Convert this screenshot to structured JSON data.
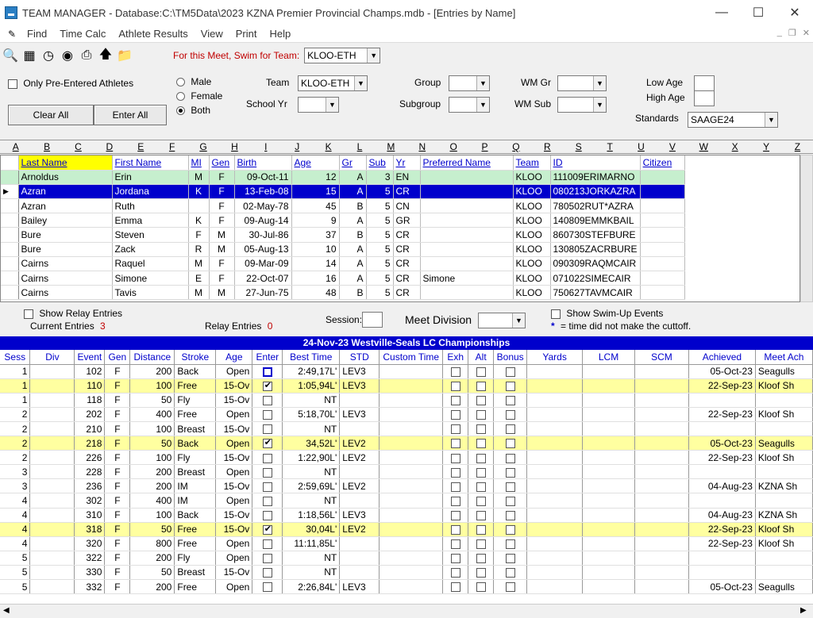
{
  "window": {
    "title": "TEAM MANAGER - Database:C:\\TM5Data\\2023 KZNA Premier Provincial Champs.mdb - [Entries by Name]"
  },
  "menu": [
    "Find",
    "Time Calc",
    "Athlete Results",
    "View",
    "Print",
    "Help"
  ],
  "toolbar": {
    "meet_label": "For this Meet, Swim for Team:",
    "team_value": "KLOO-ETH"
  },
  "filters": {
    "only_pre_entered": "Only Pre-Entered Athletes",
    "clear_all": "Clear All",
    "enter_all": "Enter All",
    "male": "Male",
    "female": "Female",
    "both": "Both",
    "team_label": "Team",
    "team_value": "KLOO-ETH",
    "school_yr_label": "School Yr",
    "group_label": "Group",
    "subgroup_label": "Subgroup",
    "wm_gr_label": "WM Gr",
    "wm_sub_label": "WM Sub",
    "low_age_label": "Low Age",
    "high_age_label": "High Age",
    "standards_label": "Standards",
    "standards_value": "SAAGE24"
  },
  "ruler": [
    "A",
    "B",
    "C",
    "D",
    "E",
    "F",
    "G",
    "H",
    "I",
    "J",
    "K",
    "L",
    "M",
    "N",
    "O",
    "P",
    "Q",
    "R",
    "S",
    "T",
    "U",
    "V",
    "W",
    "X",
    "Y",
    "Z"
  ],
  "athlete_headers": [
    "Last Name",
    "First Name",
    "MI",
    "Gen",
    "Birth",
    "Age",
    "Gr",
    "Sub",
    "Yr",
    "Preferred Name",
    "Team",
    "ID",
    "Citizen"
  ],
  "athletes": [
    [
      "Arnoldus",
      "Erin",
      "M",
      "F",
      "09-Oct-11",
      "12",
      "A",
      "3",
      "EN",
      "",
      "KLOO",
      "111009ERIMARNO",
      ""
    ],
    [
      "Azran",
      "Jordana",
      "K",
      "F",
      "13-Feb-08",
      "15",
      "A",
      "5",
      "CR",
      "",
      "KLOO",
      "080213JORKAZRA",
      ""
    ],
    [
      "Azran",
      "Ruth",
      "",
      "F",
      "02-May-78",
      "45",
      "B",
      "5",
      "CN",
      "",
      "KLOO",
      "780502RUT*AZRA",
      ""
    ],
    [
      "Bailey",
      "Emma",
      "K",
      "F",
      "09-Aug-14",
      "9",
      "A",
      "5",
      "GR",
      "",
      "KLOO",
      "140809EMMKBAIL",
      ""
    ],
    [
      "Bure",
      "Steven",
      "F",
      "M",
      "30-Jul-86",
      "37",
      "B",
      "5",
      "CR",
      "",
      "KLOO",
      "860730STEFBURE",
      ""
    ],
    [
      "Bure",
      "Zack",
      "R",
      "M",
      "05-Aug-13",
      "10",
      "A",
      "5",
      "CR",
      "",
      "KLOO",
      "130805ZACRBURE",
      ""
    ],
    [
      "Cairns",
      "Raquel",
      "M",
      "F",
      "09-Mar-09",
      "14",
      "A",
      "5",
      "CR",
      "",
      "KLOO",
      "090309RAQMCAIR",
      ""
    ],
    [
      "Cairns",
      "Simone",
      "E",
      "F",
      "22-Oct-07",
      "16",
      "A",
      "5",
      "CR",
      "Simone",
      "KLOO",
      "071022SIMECAIR",
      ""
    ],
    [
      "Cairns",
      "Tavis",
      "M",
      "M",
      "27-Jun-75",
      "48",
      "B",
      "5",
      "CR",
      "",
      "KLOO",
      "750627TAVMCAIR",
      ""
    ]
  ],
  "relay": {
    "show_relay": "Show Relay Entries",
    "current_entries_label": "Current Entries",
    "current_entries": "3",
    "relay_entries_label": "Relay Entries",
    "relay_entries": "0",
    "session_label": "Session:",
    "meet_division_label": "Meet Division",
    "show_swimup": "Show Swim-Up Events",
    "cutoff_note": "= time did not make the cuttoff."
  },
  "meet": {
    "title": "24-Nov-23  Westville-Seals LC Championships"
  },
  "event_headers": [
    "Sess",
    "Div",
    "Event",
    "Gen",
    "Distance",
    "Stroke",
    "Age",
    "Enter",
    "Best Time",
    "STD",
    "Custom Time",
    "Exh",
    "Alt",
    "Bonus",
    "Yards",
    "LCM",
    "SCM",
    "Achieved",
    "Meet Ach"
  ],
  "events": [
    {
      "sess": "1",
      "event": "102",
      "gen": "F",
      "dist": "200",
      "stroke": "Back",
      "age": "Open",
      "enter": false,
      "best": "2:49,17L'",
      "std": "LEV3",
      "achieved": "05-Oct-23",
      "meet": "Seagulls"
    },
    {
      "sess": "1",
      "event": "110",
      "gen": "F",
      "dist": "100",
      "stroke": "Free",
      "age": "15-Ov",
      "enter": true,
      "best": "1:05,94L'",
      "std": "LEV3",
      "achieved": "22-Sep-23",
      "meet": "Kloof Sh"
    },
    {
      "sess": "1",
      "event": "118",
      "gen": "F",
      "dist": "50",
      "stroke": "Fly",
      "age": "15-Ov",
      "enter": false,
      "best": "NT",
      "std": "",
      "achieved": "",
      "meet": ""
    },
    {
      "sess": "2",
      "event": "202",
      "gen": "F",
      "dist": "400",
      "stroke": "Free",
      "age": "Open",
      "enter": false,
      "best": "5:18,70L'",
      "std": "LEV3",
      "achieved": "22-Sep-23",
      "meet": "Kloof Sh"
    },
    {
      "sess": "2",
      "event": "210",
      "gen": "F",
      "dist": "100",
      "stroke": "Breast",
      "age": "15-Ov",
      "enter": false,
      "best": "NT",
      "std": "",
      "achieved": "",
      "meet": ""
    },
    {
      "sess": "2",
      "event": "218",
      "gen": "F",
      "dist": "50",
      "stroke": "Back",
      "age": "Open",
      "enter": true,
      "best": "34,52L'",
      "std": "LEV2",
      "achieved": "05-Oct-23",
      "meet": "Seagulls"
    },
    {
      "sess": "2",
      "event": "226",
      "gen": "F",
      "dist": "100",
      "stroke": "Fly",
      "age": "15-Ov",
      "enter": false,
      "best": "1:22,90L'",
      "std": "LEV2",
      "achieved": "22-Sep-23",
      "meet": "Kloof Sh"
    },
    {
      "sess": "3",
      "event": "228",
      "gen": "F",
      "dist": "200",
      "stroke": "Breast",
      "age": "Open",
      "enter": false,
      "best": "NT",
      "std": "",
      "achieved": "",
      "meet": ""
    },
    {
      "sess": "3",
      "event": "236",
      "gen": "F",
      "dist": "200",
      "stroke": "IM",
      "age": "15-Ov",
      "enter": false,
      "best": "2:59,69L'",
      "std": "LEV2",
      "achieved": "04-Aug-23",
      "meet": "KZNA Sh"
    },
    {
      "sess": "4",
      "event": "302",
      "gen": "F",
      "dist": "400",
      "stroke": "IM",
      "age": "Open",
      "enter": false,
      "best": "NT",
      "std": "",
      "achieved": "",
      "meet": ""
    },
    {
      "sess": "4",
      "event": "310",
      "gen": "F",
      "dist": "100",
      "stroke": "Back",
      "age": "15-Ov",
      "enter": false,
      "best": "1:18,56L'",
      "std": "LEV3",
      "achieved": "04-Aug-23",
      "meet": "KZNA Sh"
    },
    {
      "sess": "4",
      "event": "318",
      "gen": "F",
      "dist": "50",
      "stroke": "Free",
      "age": "15-Ov",
      "enter": true,
      "best": "30,04L'",
      "std": "LEV2",
      "achieved": "22-Sep-23",
      "meet": "Kloof Sh"
    },
    {
      "sess": "4",
      "event": "320",
      "gen": "F",
      "dist": "800",
      "stroke": "Free",
      "age": "Open",
      "enter": false,
      "best": "11:11,85L'",
      "std": "",
      "achieved": "22-Sep-23",
      "meet": "Kloof Sh"
    },
    {
      "sess": "5",
      "event": "322",
      "gen": "F",
      "dist": "200",
      "stroke": "Fly",
      "age": "Open",
      "enter": false,
      "best": "NT",
      "std": "",
      "achieved": "",
      "meet": ""
    },
    {
      "sess": "5",
      "event": "330",
      "gen": "F",
      "dist": "50",
      "stroke": "Breast",
      "age": "15-Ov",
      "enter": false,
      "best": "NT",
      "std": "",
      "achieved": "",
      "meet": ""
    },
    {
      "sess": "5",
      "event": "332",
      "gen": "F",
      "dist": "200",
      "stroke": "Free",
      "age": "Open",
      "enter": false,
      "best": "2:26,84L'",
      "std": "LEV3",
      "achieved": "05-Oct-23",
      "meet": "Seagulls"
    }
  ]
}
